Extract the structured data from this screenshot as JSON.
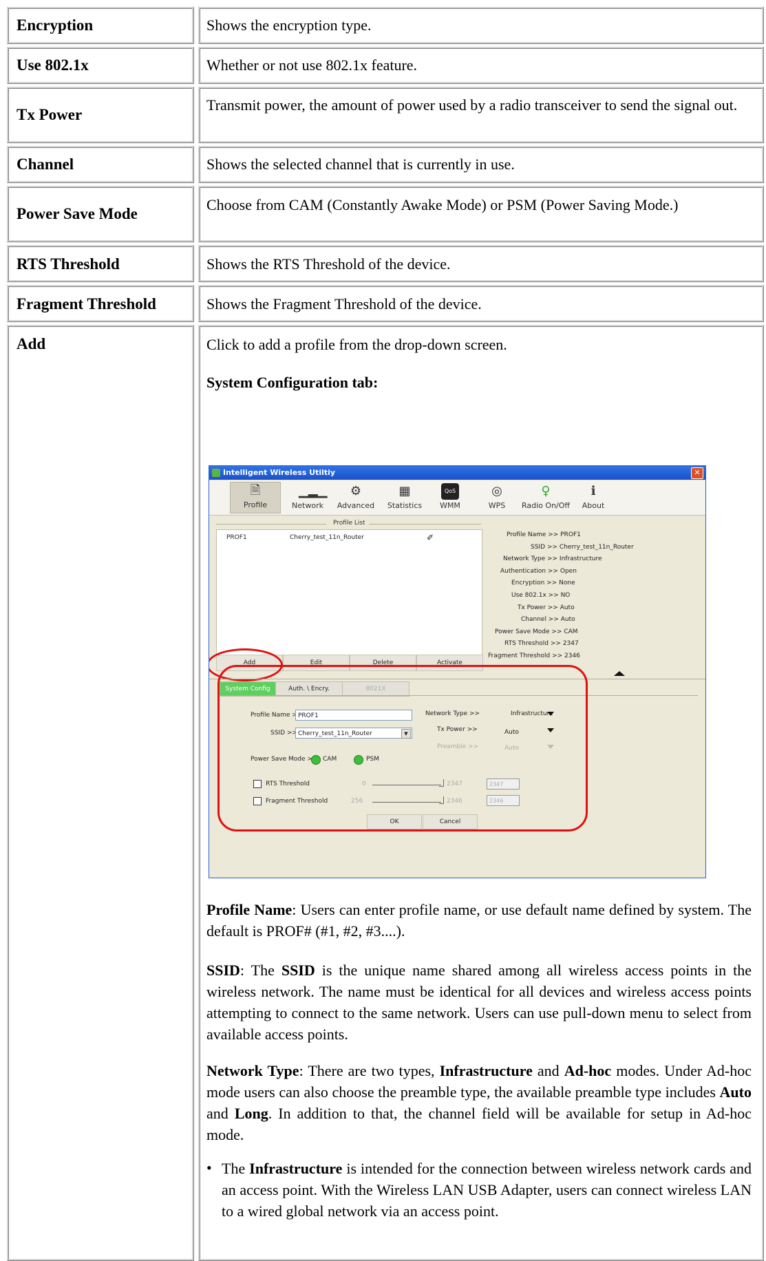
{
  "rows": [
    {
      "label": "Encryption",
      "desc": "Shows the encryption type."
    },
    {
      "label": "Use 802.1x",
      "desc": "Whether or not use 802.1x feature."
    },
    {
      "label": "Tx Power",
      "desc": "Transmit power, the amount of power used by a radio transceiver to send the signal out."
    },
    {
      "label": "Channel",
      "desc": "Shows the selected channel that is currently in use."
    },
    {
      "label": "Power Save Mode",
      "desc": "Choose from CAM (Constantly Awake Mode) or PSM (Power Saving Mode.)"
    },
    {
      "label": "RTS Threshold",
      "desc": "Shows the RTS Threshold of the device."
    },
    {
      "label": "Fragment Threshold",
      "desc": "Shows the Fragment Threshold of the device."
    },
    {
      "label": "Add",
      "desc": "Click to add a profile from the drop-down screen."
    }
  ],
  "section_heading": "System Configuration tab:",
  "window": {
    "title": "Intelligent Wireless Utiltiy",
    "close_glyph": "✕",
    "toolbar": [
      "Profile",
      "Network",
      "Advanced",
      "Statistics",
      "WMM",
      "WPS",
      "Radio On/Off",
      "About"
    ],
    "profile_list_label": "Profile List",
    "profile_row": {
      "name": "PROF1",
      "ssid": "Cherry_test_11n_Router"
    },
    "info": [
      "Profile Name >> PROF1",
      "SSID >> Cherry_test_11n_Router",
      "Network Type >> Infrastructure",
      "Authentication >> Open",
      "Encryption >> None",
      "Use 802.1x >> NO",
      "Tx Power >> Auto",
      "Channel >> Auto",
      "Power Save Mode >> CAM",
      "RTS Threshold >> 2347",
      "Fragment Threshold >> 2346"
    ],
    "buttons": [
      "Add",
      "Edit",
      "Delete",
      "Activate"
    ],
    "tabs": [
      "System Config",
      "Auth. \\ Encry.",
      "8021X"
    ],
    "form": {
      "profile_name_label": "Profile Name >>",
      "profile_name_value": "PROF1",
      "ssid_label": "SSID >>",
      "ssid_value": "Cherry_test_11n_Router",
      "network_type_label": "Network Type >>",
      "network_type_value": "Infrastructure",
      "tx_power_label": "Tx Power >>",
      "tx_power_value": "Auto",
      "preamble_label": "Preamble >>",
      "preamble_value": "Auto",
      "power_save_label": "Power Save Mode >>",
      "cam_label": "CAM",
      "psm_label": "PSM",
      "rts_label": "RTS Threshold",
      "rts_min": "0",
      "rts_max": "2347",
      "rts_value": "2347",
      "frag_label": "Fragment Threshold",
      "frag_min": "256",
      "frag_max": "2346",
      "frag_value": "2346",
      "ok": "OK",
      "cancel": "Cancel"
    }
  },
  "para_profile_name": {
    "term": "Profile Name",
    "text": ": Users can enter profile name, or use default name defined by system. The default is PROF# (#1, #2, #3....)."
  },
  "para_ssid": {
    "term": "SSID",
    "t1": ": The ",
    "term2": "SSID",
    "text": " is the unique name shared among all wireless access points in the wireless network. The name must be identical for all devices and wireless access points attempting to connect to the same network. Users can use pull-down menu to select from available access points."
  },
  "para_network_type": {
    "term": "Network Type",
    "t1": ": There are two types, ",
    "b1": "Infrastructure",
    "t2": " and ",
    "b2": "Ad-hoc",
    "t3": " modes. Under Ad-hoc mode users can also choose the preamble type, the available preamble type includes ",
    "b3": "Auto",
    "t4": " and ",
    "b4": "Long",
    "t5": ". In addition to that, the channel field will be available for setup in Ad-hoc mode."
  },
  "bullet": {
    "t1": "The ",
    "b1": "Infrastructure",
    "t2": " is intended for the connection between wireless network cards and an access point. With the Wireless LAN USB Adapter, users can connect wireless LAN to a wired global network via an access point."
  }
}
